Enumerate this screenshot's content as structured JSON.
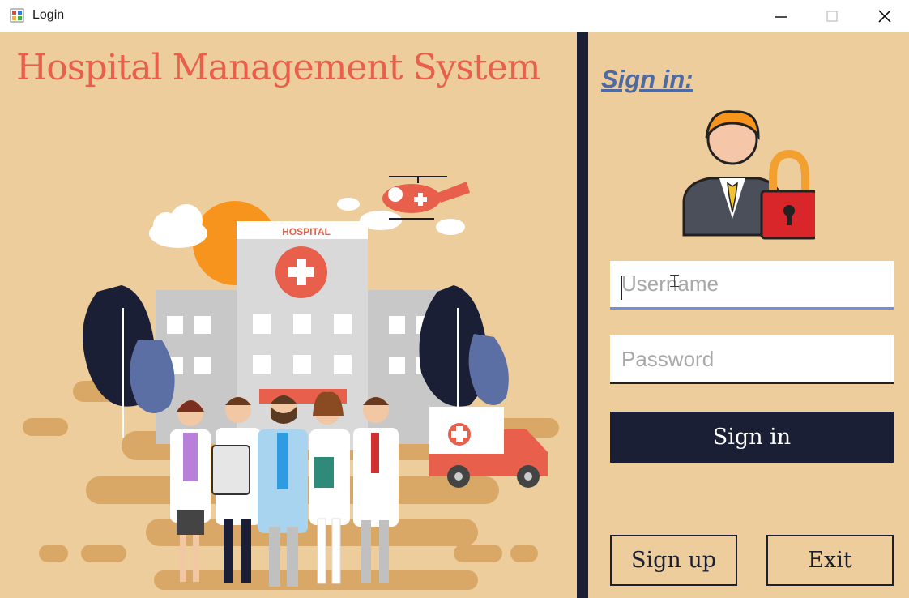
{
  "window": {
    "title": "Login",
    "controls": [
      "minimize-icon",
      "maximize-icon",
      "close-icon"
    ]
  },
  "left": {
    "app_title": "Hospital Management System",
    "illustration": {
      "building_sign": "HOSPITAL",
      "icons": [
        "hospital-building",
        "helicopter",
        "ambulance",
        "sun",
        "clouds",
        "trees",
        "doctors-group"
      ]
    }
  },
  "form": {
    "heading": "Sign in:",
    "avatar_icon": "user-lock-icon",
    "username": {
      "placeholder": "Username",
      "value": ""
    },
    "password": {
      "placeholder": "Password",
      "value": ""
    },
    "signin_label": "Sign in",
    "signup_label": "Sign up",
    "exit_label": "Exit"
  },
  "colors": {
    "background": "#eecd9c",
    "title_red": "#e8604c",
    "navy": "#1a1f36",
    "heading_blue": "#4f6aa3",
    "focus_underline": "#6f8fd6"
  }
}
